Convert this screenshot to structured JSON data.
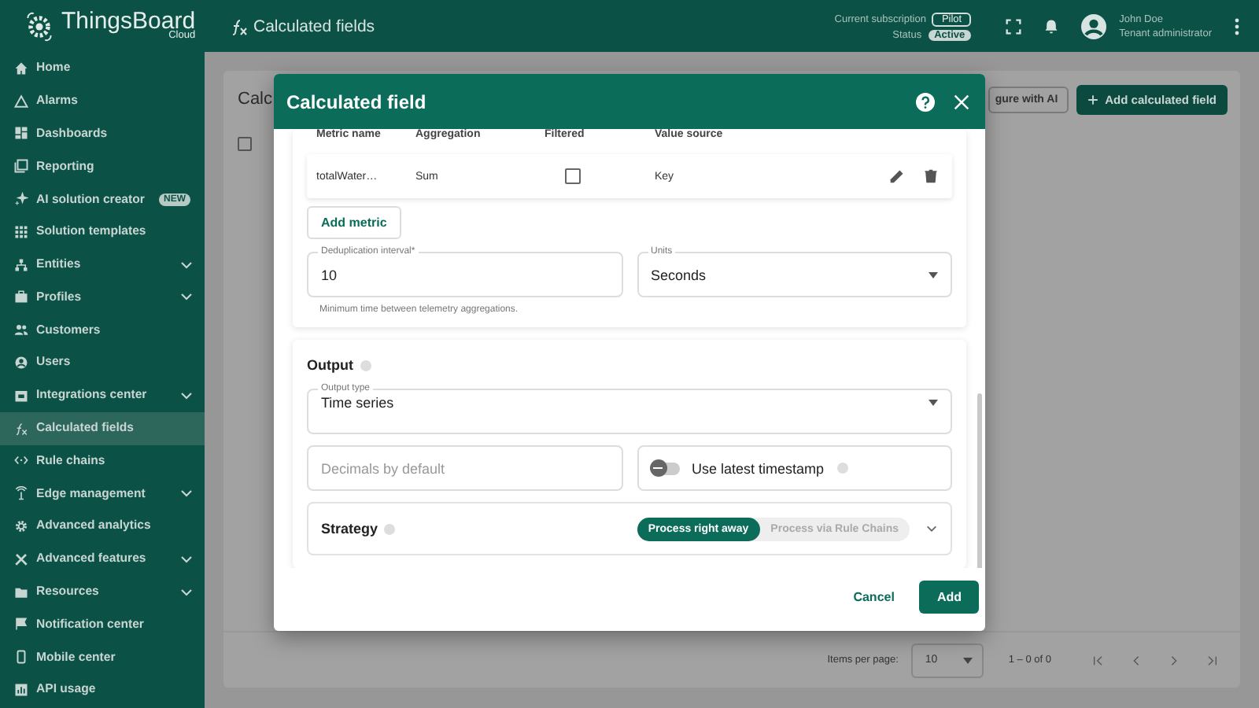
{
  "app": {
    "logo_name": "ThingsBoard",
    "logo_sub": "Cloud"
  },
  "topbar": {
    "page_title": "Calculated fields",
    "subscription_label": "Current subscription",
    "subscription": "Pilot",
    "status_label": "Status",
    "status": "Active",
    "user_name": "John Doe",
    "user_role": "Tenant administrator"
  },
  "sidebar": {
    "items": [
      {
        "label": "Home",
        "expandable": false,
        "selected": false
      },
      {
        "label": "Alarms",
        "expandable": false,
        "selected": false
      },
      {
        "label": "Dashboards",
        "expandable": false,
        "selected": false
      },
      {
        "label": "Reporting",
        "expandable": false,
        "selected": false
      },
      {
        "label": "AI solution creator",
        "expandable": false,
        "selected": false,
        "badge": "NEW"
      },
      {
        "label": "Solution templates",
        "expandable": false,
        "selected": false
      },
      {
        "label": "Entities",
        "expandable": true,
        "selected": false
      },
      {
        "label": "Profiles",
        "expandable": true,
        "selected": false
      },
      {
        "label": "Customers",
        "expandable": false,
        "selected": false
      },
      {
        "label": "Users",
        "expandable": false,
        "selected": false
      },
      {
        "label": "Integrations center",
        "expandable": true,
        "selected": false
      },
      {
        "label": "Calculated fields",
        "expandable": false,
        "selected": true
      },
      {
        "label": "Rule chains",
        "expandable": false,
        "selected": false
      },
      {
        "label": "Edge management",
        "expandable": true,
        "selected": false
      },
      {
        "label": "Advanced analytics",
        "expandable": false,
        "selected": false
      },
      {
        "label": "Advanced features",
        "expandable": true,
        "selected": false
      },
      {
        "label": "Resources",
        "expandable": true,
        "selected": false
      },
      {
        "label": "Notification center",
        "expandable": false,
        "selected": false
      },
      {
        "label": "Mobile center",
        "expandable": false,
        "selected": false
      },
      {
        "label": "API usage",
        "expandable": false,
        "selected": false
      }
    ]
  },
  "page": {
    "title": "Calc",
    "select_all_checked": false,
    "ai_button": "gure with AI",
    "add_button": "Add calculated field",
    "pagination": {
      "items_per_page_label": "Items per page:",
      "page_size": "10",
      "range": "1 – 0 of 0"
    }
  },
  "dialog": {
    "title": "Calculated field",
    "metrics_table": {
      "columns": [
        "Metric name",
        "Aggregation",
        "Filtered",
        "Value source"
      ],
      "rows": [
        {
          "metric_name": "totalWater…",
          "aggregation": "Sum",
          "filtered": false,
          "value_source": "Key"
        }
      ]
    },
    "add_metric": "Add metric",
    "dedup": {
      "label": "Deduplication interval*",
      "value": "10",
      "hint": "Minimum time between telemetry aggregations."
    },
    "units": {
      "label": "Units",
      "value": "Seconds"
    },
    "output": {
      "title": "Output",
      "type_label": "Output type",
      "type_value": "Time series",
      "decimals_placeholder": "Decimals by default",
      "latest_timestamp": {
        "label": "Use latest timestamp",
        "on": false
      },
      "strategy": {
        "label": "Strategy",
        "options": [
          {
            "label": "Process right away",
            "selected": true
          },
          {
            "label": "Process via Rule Chains",
            "selected": false
          }
        ]
      }
    },
    "actions": {
      "cancel": "Cancel",
      "confirm": "Add"
    }
  }
}
